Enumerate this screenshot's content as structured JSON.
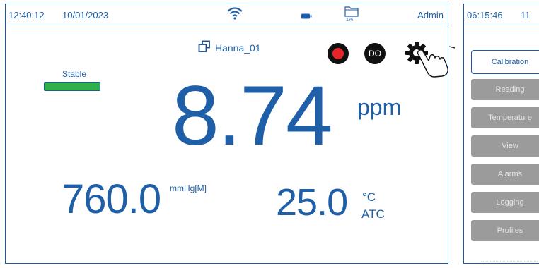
{
  "left_screen": {
    "status": {
      "time": "12:40:12",
      "date": "10/01/2023",
      "storage": "1%",
      "user": "Admin"
    },
    "instrument_name": "Hanna_01",
    "record_icon": "record-icon",
    "do_label": "DO",
    "settings_icon": "gear-icon",
    "stability_label": "Stable",
    "stability_color": "#2fb04a",
    "reading": {
      "value": "8.74",
      "unit": "ppm"
    },
    "pressure": {
      "value": "760.0",
      "unit": "mmHg[M]"
    },
    "temperature": {
      "value": "25.0",
      "unit": "°C",
      "compensation": "ATC"
    }
  },
  "right_screen": {
    "status": {
      "time": "06:15:46",
      "date_partial": "11"
    },
    "tab_label": "Calibration",
    "menu_items": [
      "Reading",
      "Temperature",
      "View",
      "Alarms",
      "Logging",
      "Profiles"
    ]
  },
  "colors": {
    "primary": "#1f5fa8",
    "record": "#e8242b",
    "menu_button": "#9b9b9b"
  }
}
